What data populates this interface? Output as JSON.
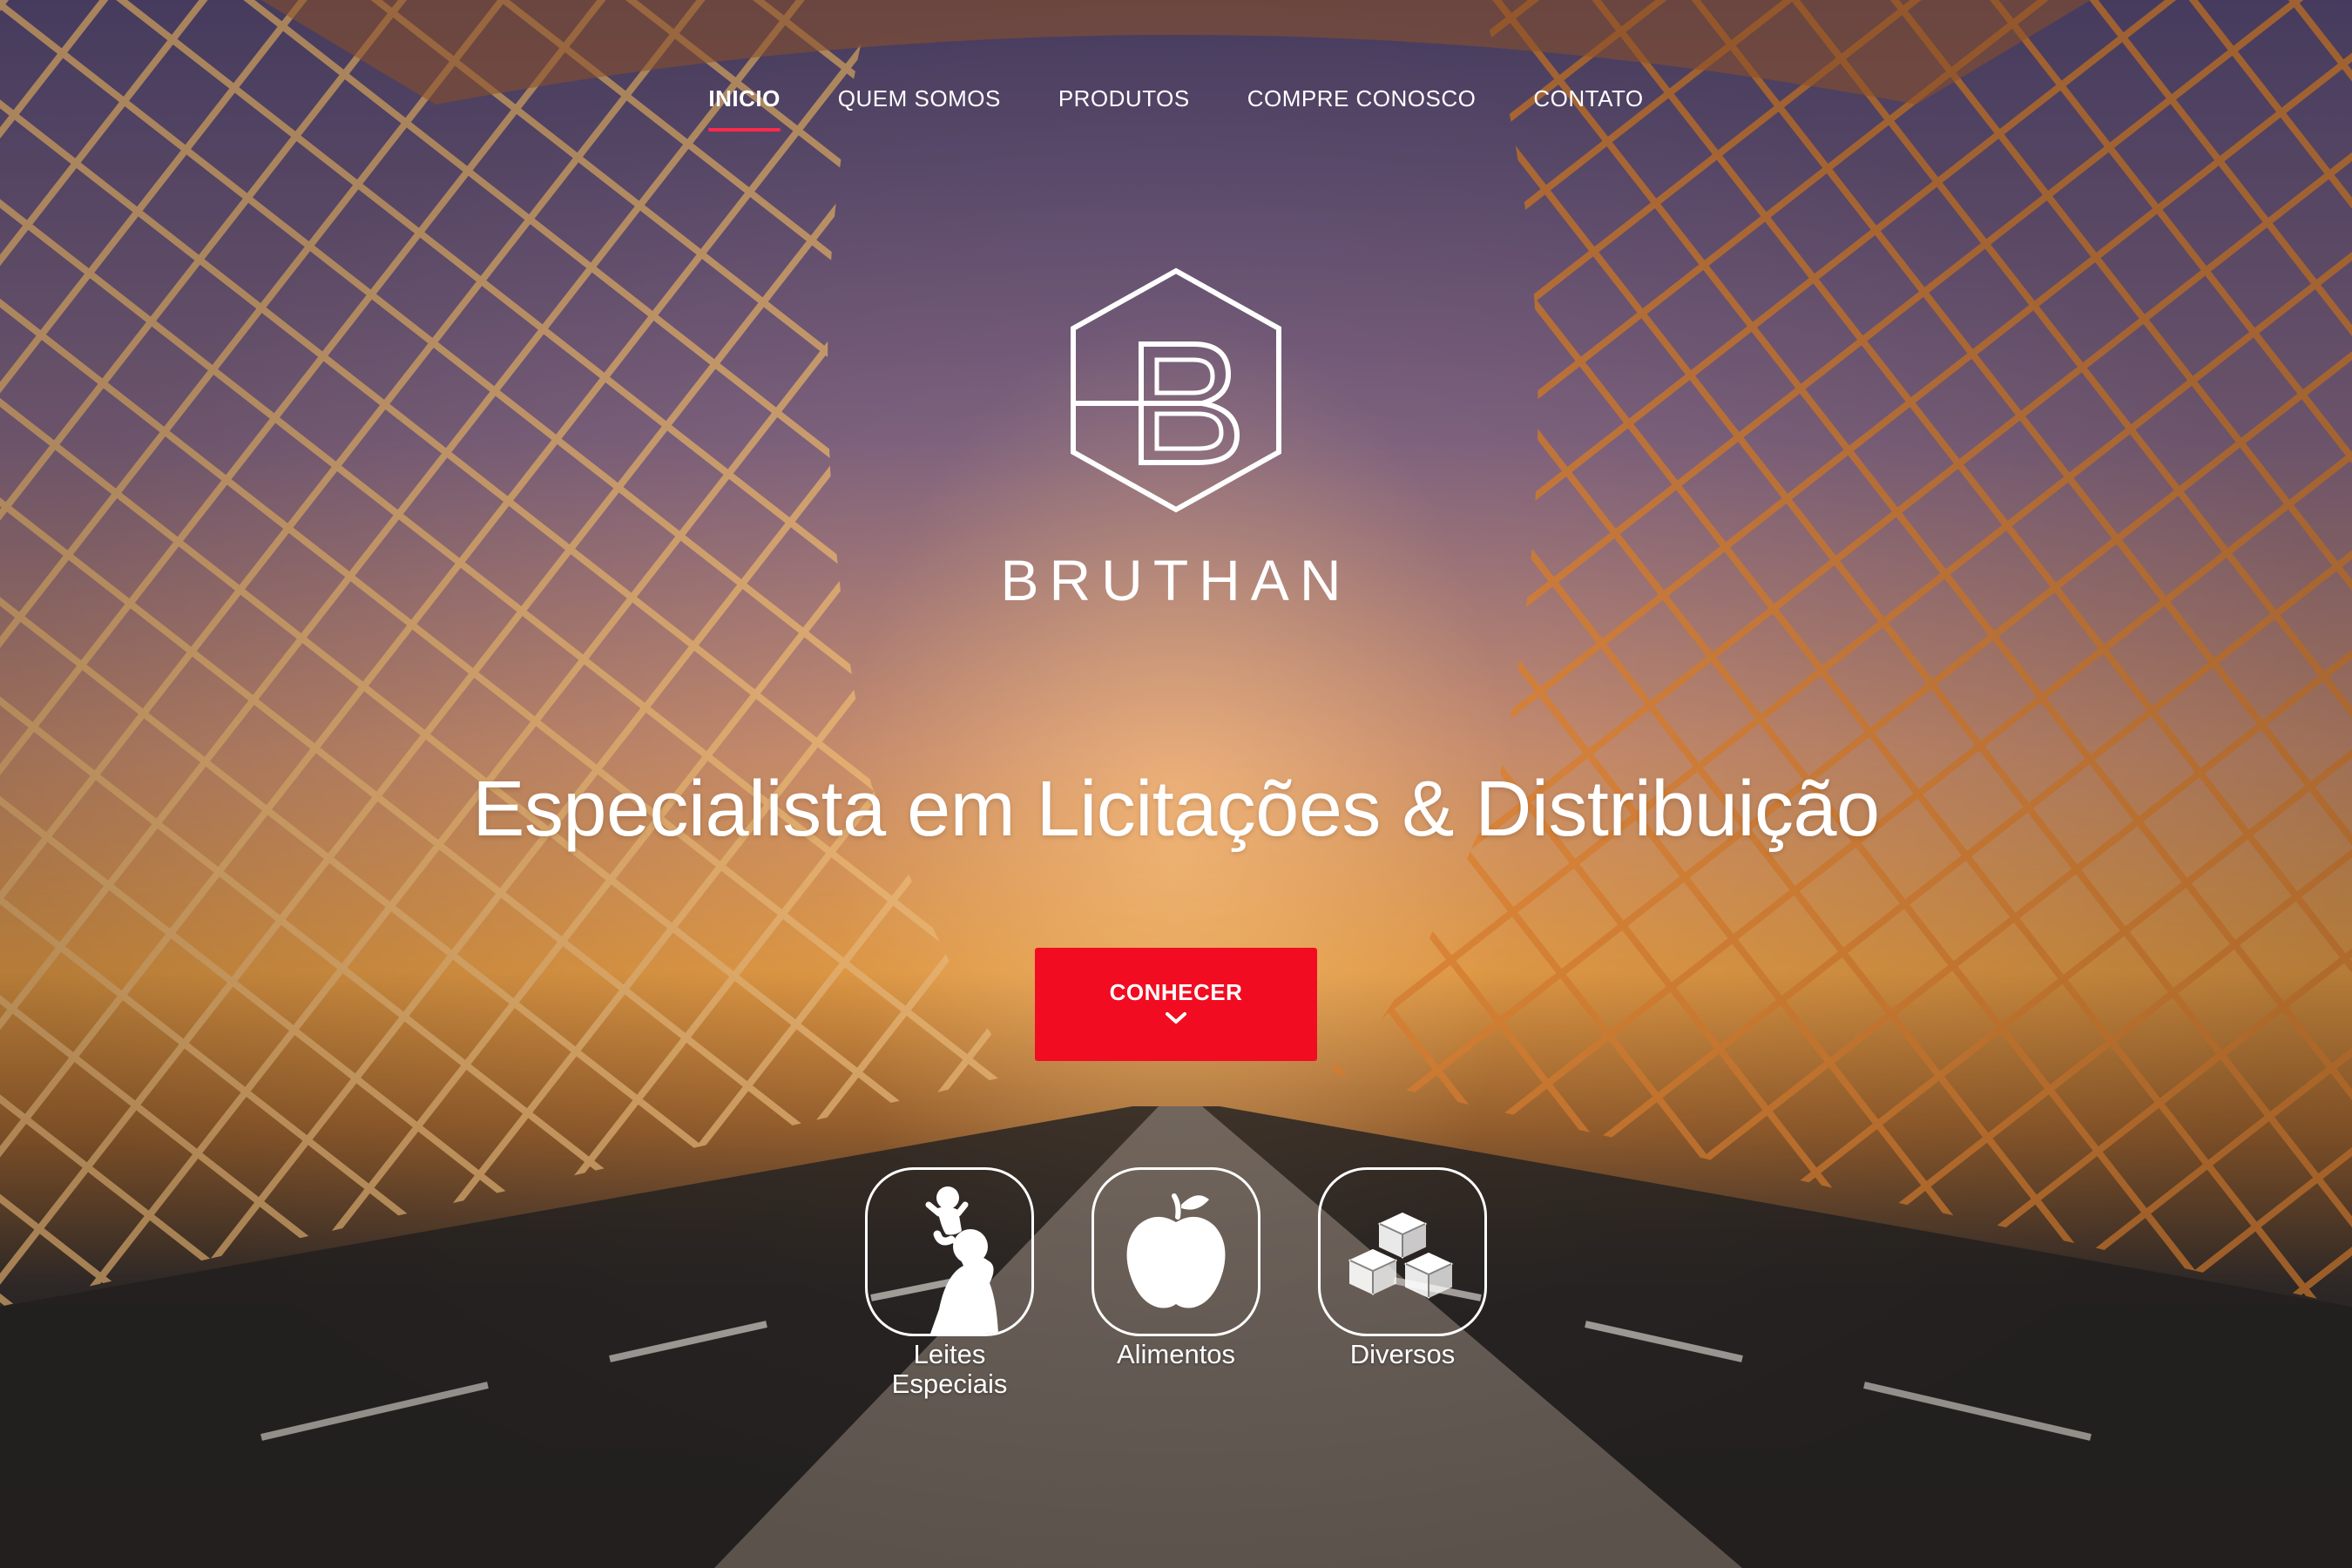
{
  "nav": {
    "items": [
      {
        "label": "INICIO",
        "active": true
      },
      {
        "label": "QUEM SOMOS",
        "active": false
      },
      {
        "label": "PRODUTOS",
        "active": false
      },
      {
        "label": "COMPRE CONOSCO",
        "active": false
      },
      {
        "label": "CONTATO",
        "active": false
      }
    ]
  },
  "brand": {
    "name": "BRUTHAN",
    "logo_icon": "hexagon-b-logo"
  },
  "hero": {
    "headline": "Especialista em Licitações & Distribuição",
    "cta_label": "CONHECER",
    "cta_color": "#f20c21",
    "accent_color": "#ff2a4b"
  },
  "categories": [
    {
      "label_line1": "Leites",
      "label_line2": "Especiais",
      "icon": "mother-baby-icon"
    },
    {
      "label_line1": "Alimentos",
      "label_line2": "",
      "icon": "apple-icon"
    },
    {
      "label_line1": "Diversos",
      "label_line2": "",
      "icon": "boxes-icon"
    }
  ]
}
